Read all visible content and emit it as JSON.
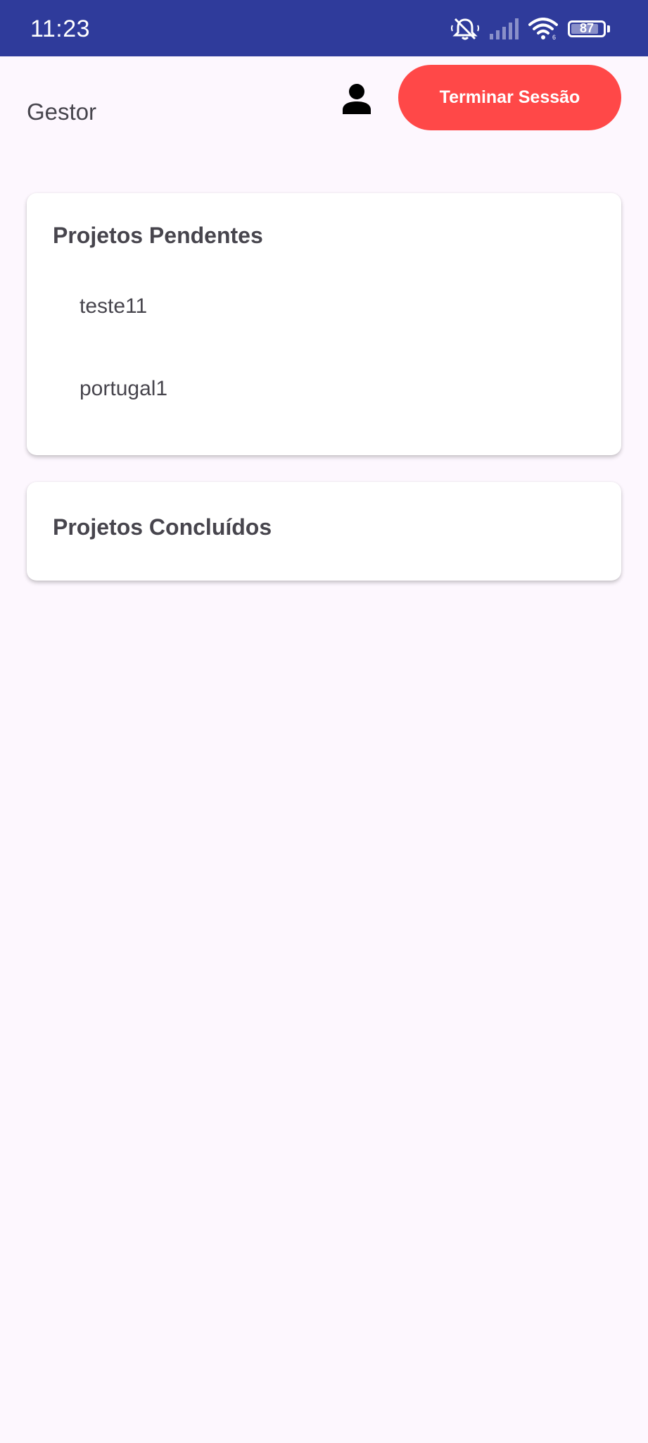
{
  "status_bar": {
    "time": "11:23",
    "battery": "87",
    "battery_level": 0.87,
    "icons": [
      "muted-bell-icon",
      "signal-icon",
      "wifi-icon",
      "battery-icon"
    ],
    "background": "#2f3b9b"
  },
  "header": {
    "role": "Gestor",
    "profile_icon": "person-icon",
    "logout_label": "Terminar Sessão",
    "logout_color": "#ff4848"
  },
  "pending": {
    "title": "Projetos Pendentes",
    "items": [
      {
        "label": "teste11"
      },
      {
        "label": "portugal1"
      }
    ]
  },
  "completed": {
    "title": "Projetos Concluídos",
    "items": []
  }
}
